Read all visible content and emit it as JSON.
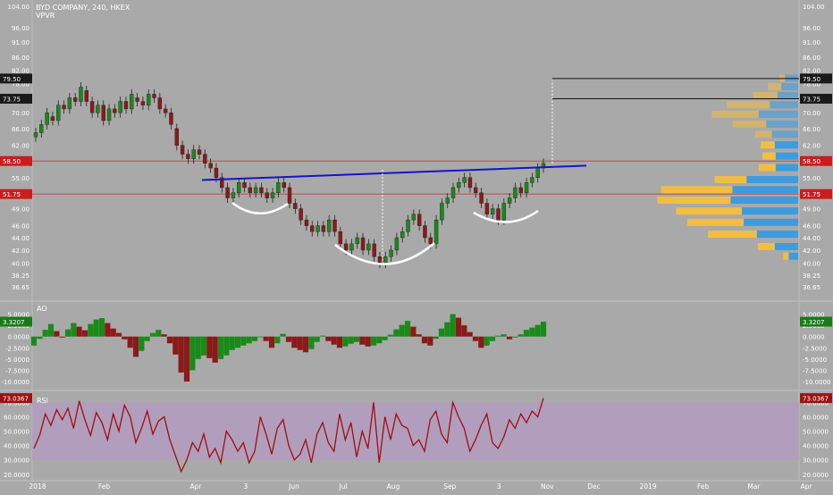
{
  "colors": {
    "background": "#a9a9a9",
    "up": "#1a8a1a",
    "down": "#8b1a1a",
    "neckline": "#1515c8",
    "vp_up": "#3d9be0",
    "vp_down": "#f2be42",
    "rsi_line": "#a00d0d",
    "rsi_band": "#b49bc4",
    "level_line": "#cc2222"
  },
  "header": {
    "symbol": "BYD COMPANY, 240, HKEX",
    "indicator": "VPVR"
  },
  "chart_data": [
    {
      "type": "candlestick",
      "title": "BYD COMPANY, 240, HKEX",
      "y_ticks": [
        "104.00",
        "96.00",
        "91.00",
        "86.00",
        "82.00",
        "78.00",
        "74.00",
        "70.00",
        "66.00",
        "62.00",
        "58.00",
        "55.00",
        "52.00",
        "49.00",
        "46.00",
        "44.00",
        "42.00",
        "40.00",
        "38.25",
        "36.65"
      ],
      "ylim": [
        36.65,
        104.0
      ],
      "y_scale": "log",
      "price_tags": [
        {
          "label": "79.50",
          "value": 79.5,
          "style": "dark"
        },
        {
          "label": "73.75",
          "value": 73.75,
          "style": "dark"
        },
        {
          "label": "58.50",
          "value": 58.5,
          "style": "red"
        },
        {
          "label": "51.75",
          "value": 51.75,
          "style": "red"
        }
      ],
      "series_close": [
        65,
        67,
        70,
        68,
        72,
        71,
        74,
        73,
        77,
        73,
        70,
        72,
        68,
        71,
        70,
        73,
        71,
        75,
        73,
        72,
        75,
        74,
        71,
        70,
        67,
        62,
        60,
        59,
        61,
        60,
        58,
        57,
        55,
        53,
        51,
        52,
        54,
        53,
        52,
        53,
        52,
        51,
        52,
        54,
        53,
        50,
        49,
        47,
        46,
        45,
        46,
        45,
        47,
        45,
        43,
        42,
        43,
        44,
        42,
        43,
        41,
        40,
        41,
        42,
        44,
        45,
        47,
        48,
        46,
        44,
        43,
        47,
        50,
        51,
        53,
        54,
        55,
        53,
        52,
        50,
        48,
        49,
        47,
        50,
        51,
        53,
        52,
        54,
        55,
        57,
        58
      ],
      "series_open": [
        64,
        65,
        67,
        69,
        68,
        72,
        71,
        74,
        73,
        76,
        73,
        70,
        72,
        68,
        71,
        70,
        73,
        71,
        74,
        73,
        72,
        75,
        74,
        71,
        70,
        66,
        62,
        60,
        59,
        61,
        60,
        58,
        57,
        55,
        53,
        51,
        52,
        54,
        53,
        52,
        53,
        52,
        51,
        52,
        54,
        53,
        50,
        49,
        47,
        46,
        45,
        46,
        45,
        47,
        45,
        43,
        42,
        43,
        44,
        42,
        43,
        41,
        40,
        41,
        42,
        44,
        45,
        47,
        48,
        46,
        44,
        43,
        47,
        50,
        51,
        53,
        54,
        55,
        53,
        52,
        50,
        48,
        49,
        47,
        50,
        51,
        53,
        52,
        54,
        55,
        57
      ],
      "annotations": [
        {
          "type": "neckline",
          "from": [
            0,
            54.5
          ],
          "to": [
            90,
            57.5
          ]
        },
        {
          "type": "head",
          "low": 40
        },
        {
          "type": "left_shoulder",
          "low": 49
        },
        {
          "type": "right_shoulder",
          "low": 47.5
        }
      ],
      "volume_profile": {
        "levels": [
          79.5,
          77.0,
          74.5,
          72.0,
          69.5,
          67.0,
          64.5,
          62.0,
          59.5,
          57.0,
          54.5,
          52.5,
          50.5,
          48.5,
          46.5,
          44.5,
          42.5,
          41.0
        ],
        "buy": [
          14,
          18,
          22,
          30,
          42,
          34,
          28,
          25,
          24,
          24,
          55,
          70,
          72,
          60,
          58,
          44,
          25,
          10
        ],
        "sell": [
          6,
          14,
          26,
          46,
          50,
          36,
          18,
          15,
          14,
          18,
          34,
          76,
          78,
          70,
          60,
          52,
          18,
          6
        ]
      }
    },
    {
      "type": "bar",
      "title": "AO",
      "y_ticks": [
        "5.0000",
        "2.5000",
        "0.0000",
        "-2.5000",
        "-5.0000",
        "-7.5000",
        "-10.0000"
      ],
      "ylim": [
        -11.0,
        6.5
      ],
      "current_label": "3.3207",
      "values": [
        -2.0,
        -0.5,
        1.5,
        2.8,
        1.2,
        -0.2,
        1.6,
        3.0,
        2.2,
        1.4,
        2.8,
        3.8,
        4.1,
        3.0,
        1.8,
        0.8,
        -0.6,
        -2.5,
        -4.5,
        -3.2,
        -1.0,
        0.8,
        1.5,
        0.5,
        -1.5,
        -4.0,
        -8.0,
        -10.0,
        -7.5,
        -5.0,
        -4.2,
        -4.8,
        -5.8,
        -5.0,
        -4.2,
        -3.0,
        -2.5,
        -2.0,
        -1.5,
        -1.0,
        0.0,
        -1.0,
        -2.5,
        -1.5,
        0.6,
        -1.2,
        -2.5,
        -3.0,
        -3.5,
        -2.8,
        -1.2,
        0.2,
        -1.0,
        -1.8,
        -2.5,
        -2.2,
        -1.6,
        -1.2,
        -1.8,
        -2.2,
        -2.0,
        -1.5,
        -0.8,
        0.4,
        1.6,
        2.6,
        3.5,
        2.2,
        0.5,
        -1.5,
        -2.0,
        -0.5,
        1.8,
        3.2,
        5.0,
        4.2,
        2.5,
        1.0,
        -1.0,
        -2.5,
        -2.0,
        -1.0,
        0.2,
        0.5,
        -0.6,
        -0.2,
        0.5,
        1.5,
        2.0,
        2.6,
        3.32
      ]
    },
    {
      "type": "line",
      "title": "RSI",
      "y_ticks": [
        "70.0000",
        "60.0000",
        "50.0000",
        "40.0000",
        "30.0000",
        "20.0000"
      ],
      "ylim": [
        18.0,
        74.0
      ],
      "band": [
        30,
        70
      ],
      "current_label": "73.0367",
      "values": [
        38,
        47,
        62,
        54,
        65,
        58,
        66,
        52,
        71,
        58,
        47,
        63,
        56,
        44,
        62,
        50,
        68,
        60,
        42,
        52,
        64,
        48,
        57,
        60,
        44,
        33,
        22,
        30,
        42,
        36,
        48,
        32,
        38,
        28,
        50,
        44,
        36,
        42,
        28,
        36,
        60,
        48,
        34,
        52,
        58,
        40,
        30,
        34,
        44,
        28,
        48,
        56,
        42,
        36,
        62,
        44,
        56,
        32,
        50,
        38,
        70,
        28,
        60,
        44,
        62,
        54,
        52,
        40,
        44,
        36,
        58,
        64,
        48,
        42,
        70,
        60,
        52,
        36,
        44,
        54,
        62,
        42,
        38,
        46,
        58,
        52,
        62,
        56,
        64,
        60,
        73
      ]
    }
  ],
  "x_axis": {
    "labels": [
      {
        "text": "2018",
        "pos": 0.045
      },
      {
        "text": "Feb",
        "pos": 0.125
      },
      {
        "text": "Apr",
        "pos": 0.235
      },
      {
        "text": "3",
        "pos": 0.295
      },
      {
        "text": "Jun",
        "pos": 0.353
      },
      {
        "text": "Jul",
        "pos": 0.412
      },
      {
        "text": "Aug",
        "pos": 0.472
      },
      {
        "text": "Sep",
        "pos": 0.54
      },
      {
        "text": "3",
        "pos": 0.599
      },
      {
        "text": "Nov",
        "pos": 0.657
      },
      {
        "text": "Dec",
        "pos": 0.713
      },
      {
        "text": "2019",
        "pos": 0.778
      },
      {
        "text": "Feb",
        "pos": 0.844
      },
      {
        "text": "Mar",
        "pos": 0.905
      },
      {
        "text": "Apr",
        "pos": 0.968
      }
    ]
  }
}
